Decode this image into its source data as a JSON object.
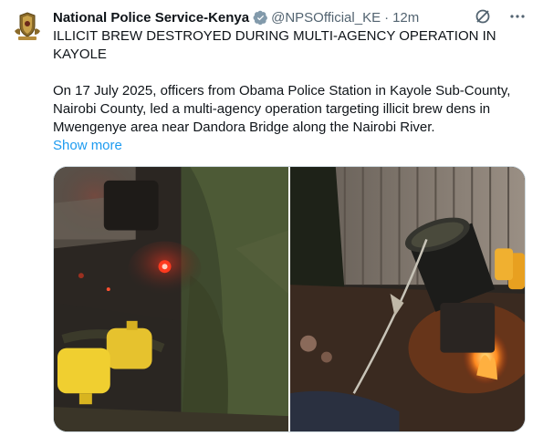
{
  "account": {
    "display_name": "National Police Service-Kenya",
    "handle": "@NPSOfficial_KE",
    "separator": "·",
    "time_ago": "12m",
    "avatar_icon": "police-crest-icon",
    "verified_icon": "verified-badge-icon"
  },
  "tweet": {
    "headline": "ILLICIT BREW DESTROYED DURING MULTI-AGENCY OPERATION IN KAYOLE",
    "body": "On 17 July 2025, officers from Obama Police Station in Kayole Sub-County, Nairobi County, led a multi-agency operation targeting illicit brew dens in Mwengenye area near Dandora Bridge along the Nairobi River.",
    "show_more_label": "Show more"
  },
  "icons": {
    "grok": "grok-icon",
    "more": "more-options-icon"
  },
  "colors": {
    "link": "#1d9bf0",
    "text": "#0f1419",
    "muted": "#536471",
    "verified_gold": "#829aab"
  }
}
